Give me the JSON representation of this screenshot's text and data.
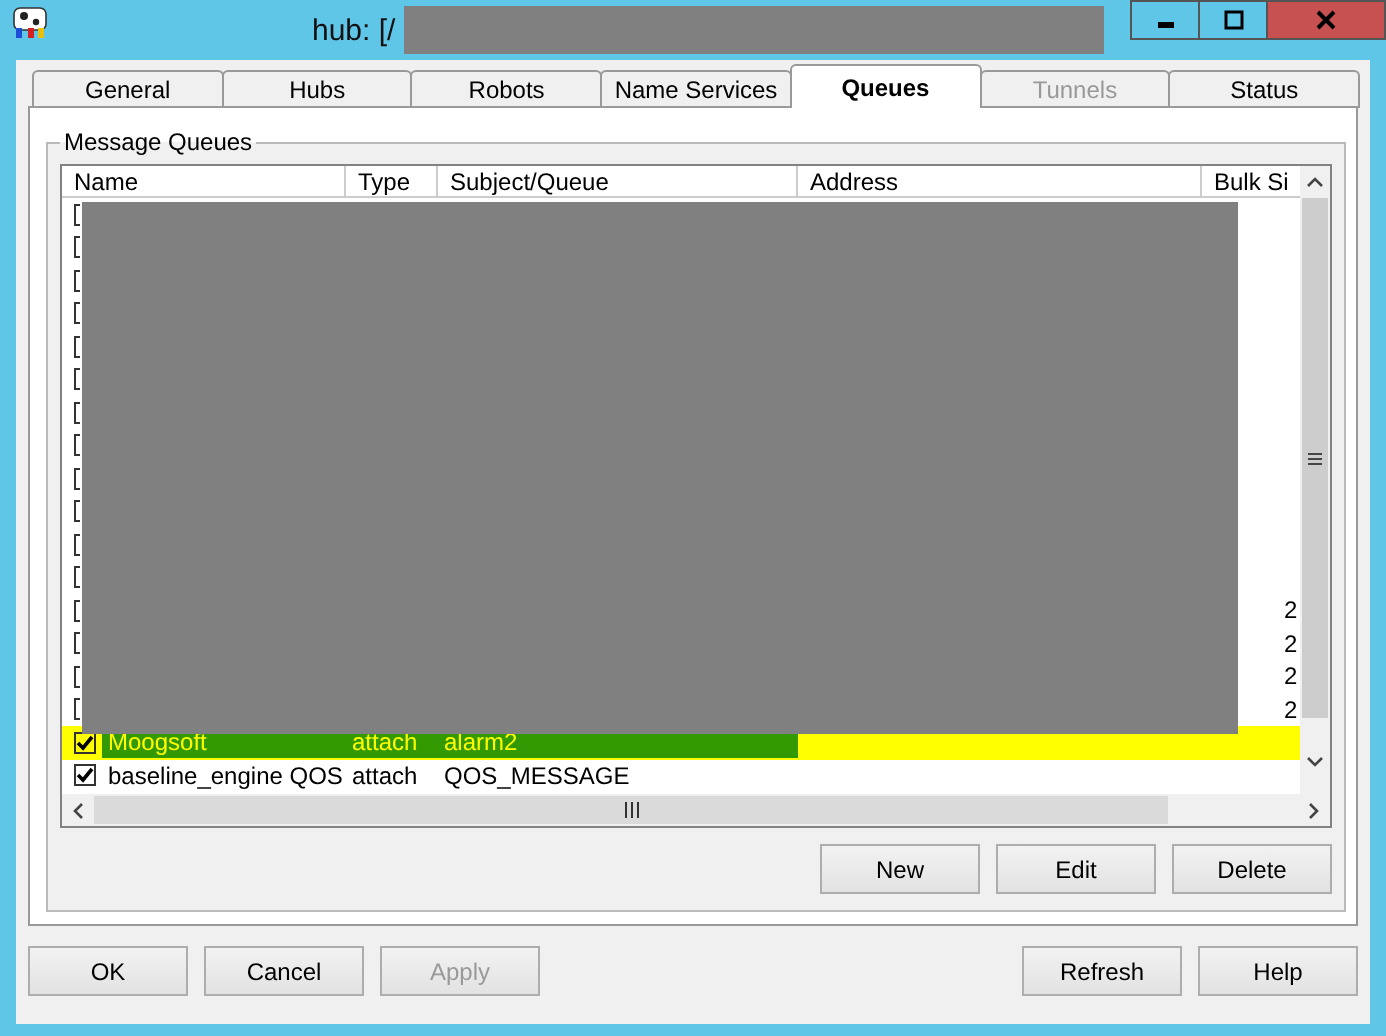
{
  "window": {
    "title": "hub: [/"
  },
  "tabs": [
    {
      "label": "General",
      "selected": false,
      "disabled": false
    },
    {
      "label": "Hubs",
      "selected": false,
      "disabled": false
    },
    {
      "label": "Robots",
      "selected": false,
      "disabled": false
    },
    {
      "label": "Name Services",
      "selected": false,
      "disabled": false
    },
    {
      "label": "Queues",
      "selected": true,
      "disabled": false
    },
    {
      "label": "Tunnels",
      "selected": false,
      "disabled": true
    },
    {
      "label": "Status",
      "selected": false,
      "disabled": false
    }
  ],
  "group": {
    "title": "Message Queues"
  },
  "table": {
    "columns": [
      "Name",
      "Type",
      "Subject/Queue",
      "Address",
      "Bulk Si"
    ],
    "rows": [
      {
        "kind": "redacted"
      },
      {
        "kind": "redacted"
      },
      {
        "kind": "redacted"
      },
      {
        "kind": "redacted"
      },
      {
        "kind": "redacted"
      },
      {
        "kind": "redacted"
      },
      {
        "kind": "redacted"
      },
      {
        "kind": "redacted"
      },
      {
        "kind": "redacted"
      },
      {
        "kind": "redacted"
      },
      {
        "kind": "redacted"
      },
      {
        "kind": "redacted"
      },
      {
        "kind": "redacted",
        "bulk": "2"
      },
      {
        "kind": "redacted",
        "bulk": "2"
      },
      {
        "kind": "redacted",
        "bulk": "2"
      },
      {
        "kind": "redacted",
        "bulk": "2"
      },
      {
        "kind": "queue",
        "checked": true,
        "selected": true,
        "name": "Moogsoft",
        "type": "attach",
        "subject": "alarm2"
      },
      {
        "kind": "queue",
        "checked": true,
        "selected": false,
        "name": "baseline_engine QOS",
        "type": "attach",
        "subject": "QOS_MESSAGE"
      }
    ]
  },
  "list_buttons": [
    {
      "label": "New",
      "disabled": false
    },
    {
      "label": "Edit",
      "disabled": false
    },
    {
      "label": "Delete",
      "disabled": false
    }
  ],
  "dialog_buttons": [
    {
      "label": "OK",
      "disabled": false
    },
    {
      "label": "Cancel",
      "disabled": false
    },
    {
      "label": "Apply",
      "disabled": true
    }
  ],
  "dialog_buttons_right": [
    {
      "label": "Refresh",
      "disabled": false
    },
    {
      "label": "Help",
      "disabled": false
    }
  ]
}
